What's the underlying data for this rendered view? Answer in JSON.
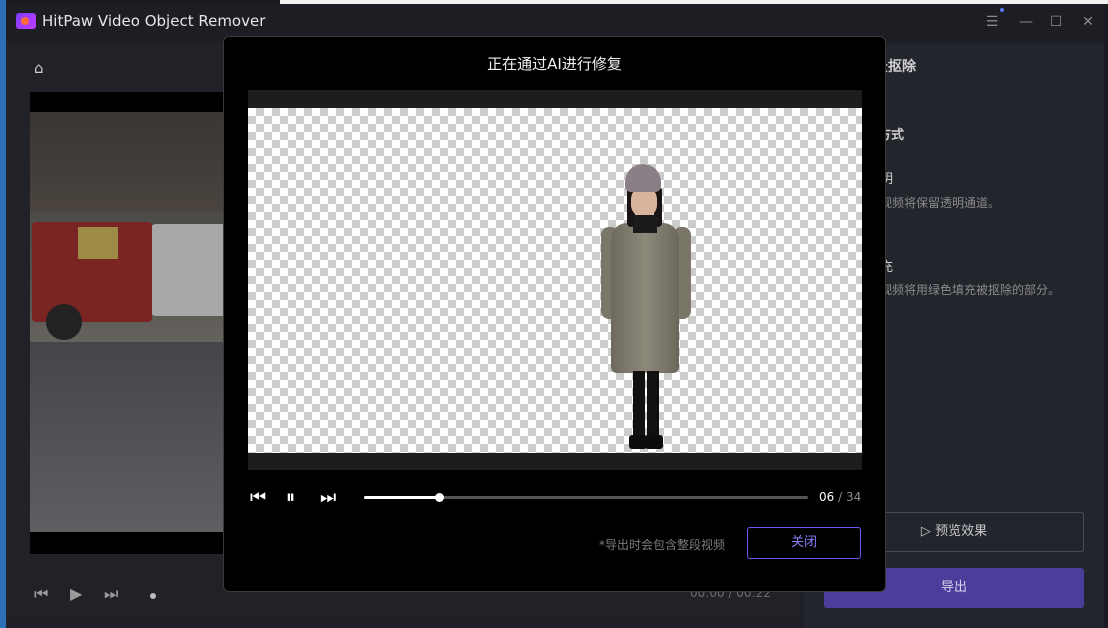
{
  "app": {
    "title": "HitPaw Video Object Remover"
  },
  "window_controls": {
    "menu": "☰",
    "minimize": "—",
    "maximize": "☐",
    "close": "✕"
  },
  "left": {
    "time_current": "00:00",
    "time_separator": "/",
    "time_total": "00:22"
  },
  "right": {
    "heading_partial": "景抠除",
    "section_partial": "方式",
    "opt1_title_partial": "明",
    "opt1_desc_partial": "视频将保留透明通道。",
    "opt2_title_partial": "充",
    "opt2_desc_partial": "视频将用绿色填充被抠除的部分。",
    "preview_label": "预览效果",
    "export_label": "导出"
  },
  "modal": {
    "title": "正在通过AI进行修复",
    "frame_current": "06",
    "frame_separator": "/",
    "frame_total": "34",
    "progress": 0.17,
    "note": "*导出时会包含整段视频",
    "close_label": "关闭"
  },
  "icons": {
    "home": "home-icon",
    "prev_frame": "step-back-icon",
    "play": "play-icon",
    "pause": "pause-icon",
    "next_frame": "step-forward-icon",
    "preview_play": "play-outline-icon"
  },
  "colors": {
    "accent": "#6a5cf0",
    "export_bg": "#4a3e9a"
  }
}
